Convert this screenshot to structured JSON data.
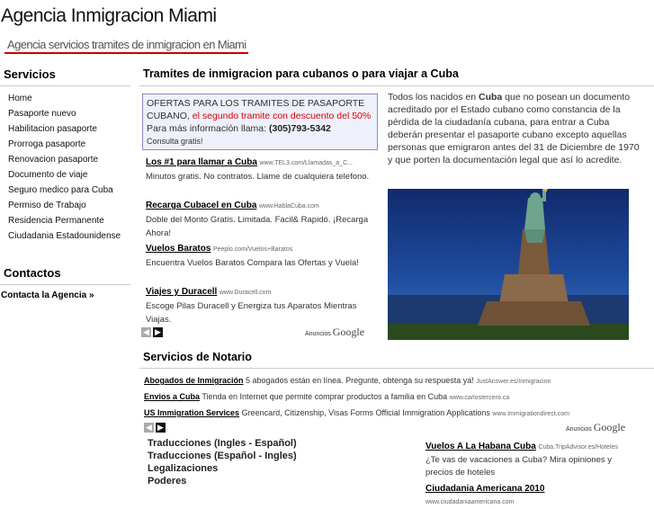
{
  "header": {
    "title": "Agencia Inmigracion Miami",
    "tagline": "Agencia servicios tramites de inmigracion en Miami",
    "accent_color": "#cc0000"
  },
  "sidebar": {
    "services_heading": "Servicios",
    "items": [
      {
        "label": "Home"
      },
      {
        "label": "Pasaporte nuevo"
      },
      {
        "label": "Habilitacion pasaporte"
      },
      {
        "label": "Prorroga pasaporte"
      },
      {
        "label": "Renovacion pasaporte"
      },
      {
        "label": "Documento de viaje"
      },
      {
        "label": "Seguro medico para Cuba"
      },
      {
        "label": "Permiso de Trabajo"
      },
      {
        "label": "Residencia Permanente"
      },
      {
        "label": "Ciudadania Estadounidense"
      }
    ],
    "contacts_heading": "Contactos",
    "contact_link": "Contacta la Agencia »"
  },
  "main": {
    "heading": "Tramites de inmigracion para cubanos o para viajar a Cuba",
    "offer": {
      "line1": "OFERTAS PARA LOS TRAMITES DE PASAPORTE CUBANO,",
      "highlight": "el segundo tramite con descuento del 50%",
      "info_label": "Para más información llama:",
      "phone": "(305)793-5342",
      "consult": "Consulta gratis!"
    },
    "ads": [
      {
        "title": "Los #1 para llamar a Cuba",
        "url": "www.TEL3.com/Llamadas_a_C...",
        "desc": "Minutos gratis. No contratos. Llame de cualquiera telefono."
      },
      {
        "title": "Recarga Cubacel en Cuba",
        "url": "www.HablaCuba.com",
        "desc": "Doble del Monto Gratis. Limitada. Facil& Rapidó. ¡Recarga Ahora!"
      },
      {
        "title": "Vuelos Baratos",
        "url": "Peeplo.com/Vuelos+Baratos",
        "desc": "Encuentra Vuelos Baratos Compara las Ofertas y Vuela!"
      },
      {
        "title": "Viajes y Duracell",
        "url": "www.Duracell.com",
        "desc": "Escoge Pilas Duracell y Energiza tus Aparatos Mientras Viajas."
      }
    ],
    "ads_label": "Anuncios",
    "ads_brand": "Google",
    "intro": {
      "before": "Todos los nacidos en ",
      "bold": "Cuba",
      "after": " que no posean un documento acreditado por el Estado cubano como constancia de la pérdida de la ciudadanía cubana, para entrar a Cuba deberán presentar el pasaporte cubano excepto aquellas personas que emigraron antes del 31 de Diciembre de 1970 y que porten la documentación legal que así lo acredite."
    },
    "photo_icon": "statue-of-liberty-photo",
    "notary": {
      "heading": "Servicios de Notario",
      "ads": [
        {
          "title": "Abogados de Inmigración",
          "desc": "5 abogados están en línea. Pregunte, obtenga su respuesta ya!",
          "url": "JustAnswer.es/Inmigracion"
        },
        {
          "title": "Envios a Cuba",
          "desc": "Tienda en Internet que permite comprar productos a familia en Cuba",
          "url": "www.carlostercero.ca"
        },
        {
          "title": "US Immigration Services",
          "desc": "Greencard, Citizenship, Visas Forms Official Immigration Applications",
          "url": "www.Immigrationdirect.com"
        }
      ],
      "services": [
        {
          "label": "Traducciones (Ingles - Español)"
        },
        {
          "label": "Traducciones (Español - Ingles)"
        },
        {
          "label": "Legalizaciones"
        },
        {
          "label": "Poderes"
        }
      ],
      "side_ads": [
        {
          "title": "Vuelos A La Habana Cuba",
          "url": "Cuba.TripAdvisor.es/Hoteles",
          "desc": "¿Te vas de vacaciones a Cuba? Mira opiniones y precios de hoteles"
        },
        {
          "title": "Ciudadania Americana 2010",
          "url": "www.ciudadaniaamericana.com",
          "desc": ""
        }
      ]
    }
  }
}
